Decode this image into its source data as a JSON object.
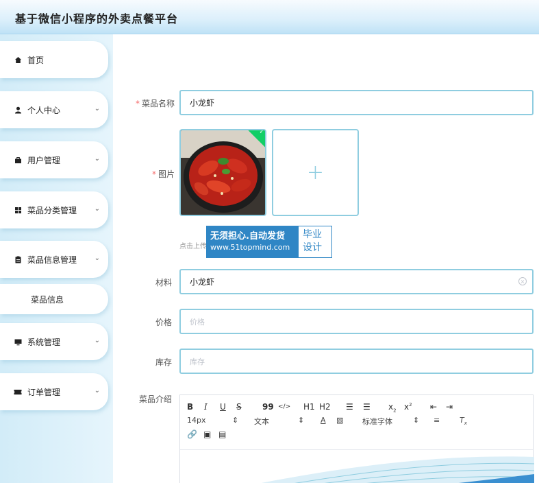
{
  "header": {
    "title": "基于微信小程序的外卖点餐平台"
  },
  "sidebar": {
    "items": [
      {
        "label": "首页",
        "icon": "home-icon",
        "has_chevron": false
      },
      {
        "label": "个人中心",
        "icon": "user-icon",
        "has_chevron": true
      },
      {
        "label": "用户管理",
        "icon": "briefcase-icon",
        "has_chevron": true
      },
      {
        "label": "菜品分类管理",
        "icon": "grid-icon",
        "has_chevron": true
      },
      {
        "label": "菜品信息管理",
        "icon": "clipboard-icon",
        "has_chevron": true
      },
      {
        "label": "菜品信息",
        "icon": "",
        "has_chevron": false
      },
      {
        "label": "系统管理",
        "icon": "monitor-icon",
        "has_chevron": true
      },
      {
        "label": "订单管理",
        "icon": "ticket-icon",
        "has_chevron": true
      }
    ]
  },
  "form": {
    "name": {
      "label": "菜品名称",
      "required": true,
      "value": "小龙虾"
    },
    "image": {
      "label": "图片",
      "required": true,
      "upload_tip": "点击上传"
    },
    "material": {
      "label": "材料",
      "value": "小龙虾"
    },
    "price": {
      "label": "价格",
      "placeholder": "价格"
    },
    "stock": {
      "label": "库存",
      "placeholder": "库存"
    },
    "intro": {
      "label": "菜品介绍"
    }
  },
  "editor": {
    "row1": [
      "B",
      "I",
      "U",
      "S",
      "99",
      "</>",
      "H1",
      "H2",
      "ol",
      "ul",
      "x2",
      "x2",
      "indent-left",
      "indent-right"
    ],
    "font_size": "14px",
    "text_style": "文本",
    "font_family": "标准字体"
  },
  "watermark": {
    "line1": "无须担心.自动发货",
    "line2": "www.51topmind.com",
    "right1": "毕业",
    "right2": "设计"
  },
  "colors": {
    "accent": "#8fcde0",
    "brand_blue": "#2f86c5",
    "required": "#f56c6c"
  }
}
